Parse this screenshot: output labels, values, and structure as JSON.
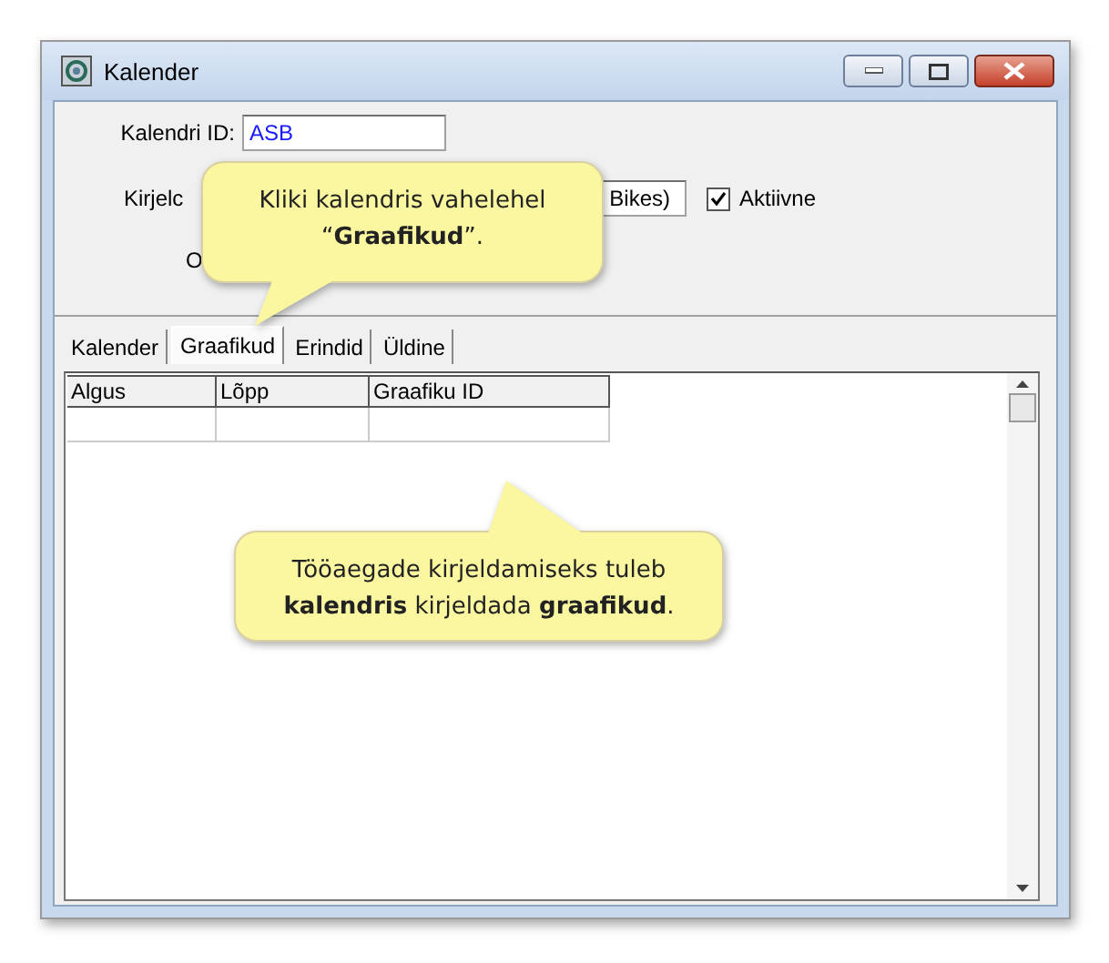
{
  "window": {
    "title": "Kalender"
  },
  "form": {
    "calendar_id_label": "Kalendri ID:",
    "calendar_id_value": "ASB",
    "description_label": "Kirjelc",
    "description_value": "Bikes)",
    "active_checkbox": {
      "label": "Aktiivne",
      "checked": true
    },
    "status_label": "O"
  },
  "tabs": [
    {
      "label": "Kalender",
      "selected": false
    },
    {
      "label": "Graafikud",
      "selected": true
    },
    {
      "label": "Erindid",
      "selected": false
    },
    {
      "label": "Üldine",
      "selected": false
    }
  ],
  "table": {
    "columns": [
      "Algus",
      "Lõpp",
      "Graafiku ID"
    ]
  },
  "callouts": [
    {
      "text": "Kliki kalendris vahelehel “**Graafikud**”."
    },
    {
      "text": "Tööaegade kirjeldamiseks tuleb **kalendris** kirjeldada **graafikud**."
    }
  ]
}
